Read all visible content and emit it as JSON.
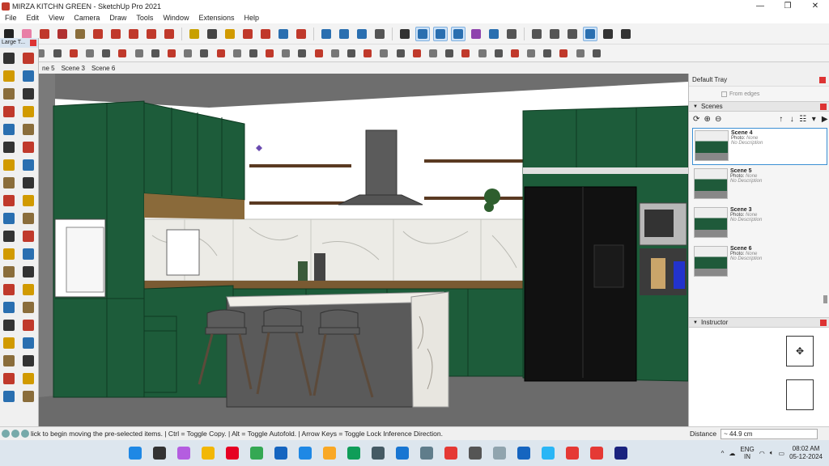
{
  "window": {
    "title": "MIRZA KITCHN GREEN - SketchUp Pro 2021",
    "minimize": "—",
    "maximize": "❐",
    "close": "✕"
  },
  "menu": [
    "File",
    "Edit",
    "View",
    "Camera",
    "Draw",
    "Tools",
    "Window",
    "Extensions",
    "Help"
  ],
  "toolbar1": [
    {
      "icon": "select-icon",
      "color": "#222222"
    },
    {
      "icon": "eraser-icon",
      "color": "#e87fa7"
    },
    {
      "icon": "pencil-icon",
      "color": "#c0392b"
    },
    {
      "icon": "arc-icon",
      "color": "#b03030"
    },
    {
      "icon": "shapes-icon",
      "color": "#8a6d3b"
    },
    {
      "icon": "push-pull-icon",
      "color": "#c0392b"
    },
    {
      "icon": "follow-me-icon",
      "color": "#c0392b"
    },
    {
      "icon": "move-icon",
      "color": "#c0392b"
    },
    {
      "icon": "rotate-icon",
      "color": "#c0392b"
    },
    {
      "icon": "scale-icon",
      "color": "#c0392b"
    },
    {
      "icon": "tape-measure-icon",
      "color": "#c8a000"
    },
    {
      "icon": "text-icon",
      "color": "#444444"
    },
    {
      "icon": "paint-bucket-icon",
      "color": "#d19a00"
    },
    {
      "icon": "orbit-icon",
      "color": "#c0392b"
    },
    {
      "icon": "pan-icon",
      "color": "#c0392b"
    },
    {
      "icon": "zoom-icon",
      "color": "#2a6fb0"
    },
    {
      "icon": "zoom-extents-icon",
      "color": "#c0392b"
    },
    {
      "icon": "warehouse-icon",
      "color": "#2a6fb0"
    },
    {
      "icon": "extension-warehouse-icon",
      "color": "#2a6fb0"
    },
    {
      "icon": "layout-icon",
      "color": "#2a6fb0"
    },
    {
      "icon": "user-icon",
      "color": "#555555"
    },
    {
      "icon": "axes-icon",
      "color": "#333333"
    },
    {
      "icon": "iso-view-icon",
      "color": "#2a6fb0",
      "active": true
    },
    {
      "icon": "top-view-icon",
      "color": "#2a6fb0",
      "active": true
    },
    {
      "icon": "front-view-icon",
      "color": "#2a6fb0",
      "active": true
    },
    {
      "icon": "plugin-p-icon",
      "color": "#8e44ad"
    },
    {
      "icon": "xray-icon",
      "color": "#2a6fb0"
    },
    {
      "icon": "back-edges-icon",
      "color": "#555555"
    },
    {
      "icon": "wireframe-icon",
      "color": "#555555"
    },
    {
      "icon": "camera-icon",
      "color": "#555555"
    },
    {
      "icon": "snapshot-icon",
      "color": "#555555"
    },
    {
      "icon": "history-icon",
      "color": "#2a6fb0",
      "active": true
    },
    {
      "icon": "settings-icon",
      "color": "#333333"
    },
    {
      "icon": "box-icon",
      "color": "#333333"
    }
  ],
  "toolbar2": [
    "wall-icon",
    "door-icon",
    "window-icon",
    "stair-icon",
    "roof-icon",
    "beam-icon",
    "column-icon",
    "curve-icon",
    "fillet-icon",
    "chamfer-icon",
    "offset-icon",
    "extrude-icon",
    "loft-icon",
    "split-icon",
    "mirror-icon",
    "array-icon",
    "path-icon",
    "align-icon",
    "flip-icon",
    "joint-icon",
    "profile-icon",
    "cut-icon",
    "shell-icon",
    "round-icon",
    "bevel-icon",
    "subdivide-icon",
    "smooth-icon",
    "weld-icon",
    "explode-icon",
    "group-icon",
    "component-icon",
    "tag-icon",
    "light-icon",
    "cone-icon",
    "line-icon",
    "square-icon",
    "visibility-icon"
  ],
  "scenes_tabs": [
    "ne 5",
    "Scene 3",
    "Scene 6"
  ],
  "left_panel": {
    "title": "Large T..."
  },
  "left_tools": [
    "select-icon",
    "make-component-icon",
    "paint-bucket-icon",
    "eraser-icon",
    "pencil-icon",
    "freehand-icon",
    "rectangle-icon",
    "rotated-rect-icon",
    "circle-icon",
    "polygon-icon",
    "arc-icon",
    "two-point-arc-icon",
    "three-point-arc-icon",
    "pie-icon",
    "move-icon",
    "push-pull-icon",
    "rotate-icon",
    "follow-me-icon",
    "scale-icon",
    "offset-icon",
    "tape-measure-icon",
    "dimension-icon",
    "protractor-icon",
    "text-icon",
    "axes-icon",
    "3d-text-icon",
    "orbit-icon",
    "pan-icon",
    "zoom-icon",
    "zoom-window-icon",
    "zoom-extents-icon",
    "previous-view-icon",
    "position-camera-icon",
    "look-around-icon",
    "walk-icon",
    "section-plane-icon",
    "warehouse-icon",
    "extension-icon",
    "layout-icon",
    "share-icon"
  ],
  "default_tray": {
    "title": "Default Tray",
    "from_edges": "From edges",
    "scenes_title": "Scenes",
    "scenes": [
      {
        "name": "Scene 4",
        "photo_label": "Photo:",
        "photo_value": "None",
        "desc": "No Description",
        "selected": true
      },
      {
        "name": "Scene 5",
        "photo_label": "Photo:",
        "photo_value": "None",
        "desc": "No Description",
        "selected": false
      },
      {
        "name": "Scene 3",
        "photo_label": "Photo:",
        "photo_value": "None",
        "desc": "No Description",
        "selected": false
      },
      {
        "name": "Scene 6",
        "photo_label": "Photo:",
        "photo_value": "None",
        "desc": "No Description",
        "selected": false
      }
    ],
    "instructor_title": "Instructor"
  },
  "status": {
    "text": "lick to begin moving the pre-selected items. | Ctrl = Toggle Copy. | Alt = Toggle Autofold. | Arrow Keys = Toggle Lock Inference Direction.",
    "distance_label": "Distance",
    "distance_value": "~ 44.9 cm"
  },
  "taskbar": {
    "apps": [
      {
        "icon": "windows-start-icon",
        "color": "#1e88e5"
      },
      {
        "icon": "search-icon",
        "color": "#333333"
      },
      {
        "icon": "copilot-icon",
        "color": "#b45de0"
      },
      {
        "icon": "file-explorer-icon",
        "color": "#f2b705"
      },
      {
        "icon": "pinterest-icon",
        "color": "#e60023"
      },
      {
        "icon": "chrome-icon",
        "color": "#34a853"
      },
      {
        "icon": "store-icon",
        "color": "#1565c0"
      },
      {
        "icon": "mail-icon",
        "color": "#1e88e5"
      },
      {
        "icon": "explorer-icon",
        "color": "#f9a825"
      },
      {
        "icon": "edge-icon",
        "color": "#0f9d58"
      },
      {
        "icon": "calculator-icon",
        "color": "#455a64"
      },
      {
        "icon": "chat-icon",
        "color": "#1976d2"
      },
      {
        "icon": "camera-app-icon",
        "color": "#607d8b"
      },
      {
        "icon": "youtube-icon",
        "color": "#e53935"
      },
      {
        "icon": "chatgpt-icon",
        "color": "#555555"
      },
      {
        "icon": "notepad-icon",
        "color": "#90a4ae"
      },
      {
        "icon": "sketchup-icon",
        "color": "#1565c0"
      },
      {
        "icon": "telegram-icon",
        "color": "#29b6f6"
      },
      {
        "icon": "media-player-icon",
        "color": "#e53935"
      },
      {
        "icon": "grid-app-icon",
        "color": "#e53935"
      },
      {
        "icon": "r-app-icon",
        "color": "#1a237e"
      }
    ],
    "tray_up": "^",
    "weather": "☁",
    "lang_top": "ENG",
    "lang_bottom": "IN",
    "wifi": "◠",
    "time": "08:02 AM",
    "date": "05-12-2024"
  }
}
